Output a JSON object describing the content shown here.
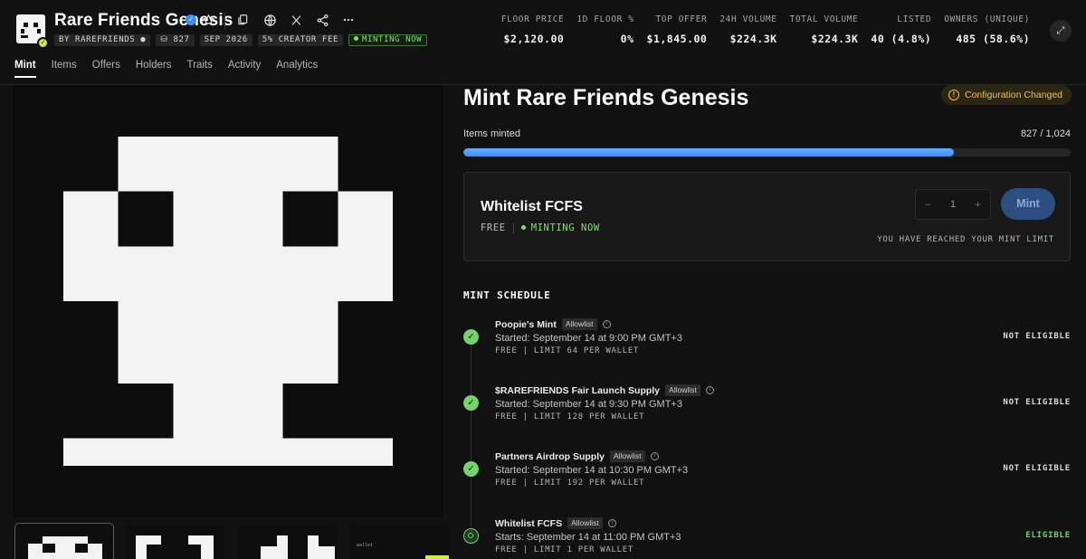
{
  "collection": {
    "name": "Rare Friends Genesis",
    "creator": "BY RAREFRIENDS",
    "items_count": "827",
    "date": "SEP 2026",
    "creator_fee": "5% CREATOR FEE",
    "status": "MINTING NOW"
  },
  "stats": [
    {
      "label": "FLOOR PRICE",
      "value": "$2,120.00"
    },
    {
      "label": "1D FLOOR %",
      "value": "0%"
    },
    {
      "label": "TOP OFFER",
      "value": "$1,845.00"
    },
    {
      "label": "24H VOLUME",
      "value": "$224.3K"
    },
    {
      "label": "TOTAL VOLUME",
      "value": "$224.3K"
    },
    {
      "label": "LISTED",
      "value": "40 (4.8%)"
    },
    {
      "label": "OWNERS (UNIQUE)",
      "value": "485 (58.6%)"
    }
  ],
  "tabs": [
    "Mint",
    "Items",
    "Offers",
    "Holders",
    "Traits",
    "Activity",
    "Analytics"
  ],
  "mint": {
    "title": "Mint Rare Friends Genesis",
    "config_badge": "Configuration Changed",
    "items_minted_label": "Items minted",
    "items_minted_count": "827 / 1,024",
    "progress": 0.8076,
    "phase": {
      "name": "Whitelist FCFS",
      "price": "FREE",
      "status": "MINTING NOW",
      "quantity": "1",
      "minus": "−",
      "plus": "+",
      "button": "Mint",
      "limit_note": "YOU HAVE REACHED YOUR MINT LIMIT"
    }
  },
  "schedule": {
    "title": "MINT SCHEDULE",
    "phases": [
      {
        "name": "Poopie's Mint",
        "badge": "Allowlist",
        "time": "Started: September 14 at 9:00 PM GMT+3",
        "limit": "FREE | LIMIT 64 PER WALLET",
        "status": "NOT ELIGIBLE",
        "icon": "check-icon"
      },
      {
        "name": "$RAREFRIENDS Fair Launch Supply",
        "badge": "Allowlist",
        "time": "Started: September 14 at 9:30 PM GMT+3",
        "limit": "FREE | LIMIT 128 PER WALLET",
        "status": "NOT ELIGIBLE",
        "icon": "check-icon"
      },
      {
        "name": "Partners Airdrop Supply",
        "badge": "Allowlist",
        "time": "Started: September 14 at 10:30 PM GMT+3",
        "limit": "FREE | LIMIT 192 PER WALLET",
        "status": "NOT ELIGIBLE",
        "icon": "check-icon"
      },
      {
        "name": "Whitelist FCFS",
        "badge": "Allowlist",
        "time": "Starts: September 14 at 11:00 PM GMT+3",
        "limit": "FREE | LIMIT 1 PER WALLET",
        "status": "ELIGIBLE",
        "icon": "pending-icon"
      }
    ]
  },
  "thumbnail_caption": "wallet",
  "colors": {
    "accent": "#4a9af5",
    "eligible": "#72d46a",
    "warning": "#f0c32e",
    "background": "#111111"
  },
  "icons": [
    "star-icon",
    "copy-icon",
    "globe-icon",
    "x-icon",
    "share-icon",
    "more-icon",
    "expand-icon",
    "verified-icon",
    "info-icon"
  ]
}
